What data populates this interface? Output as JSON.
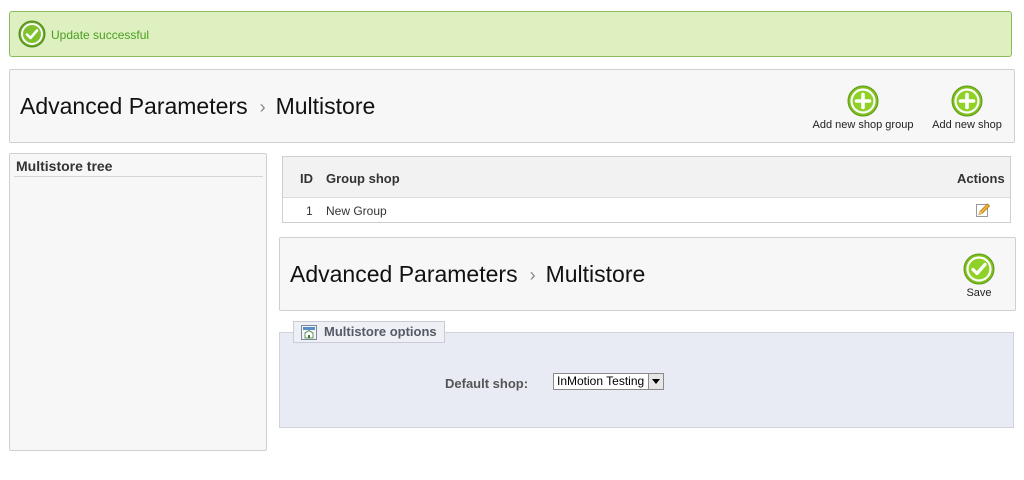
{
  "notification": {
    "message": "Update successful"
  },
  "header": {
    "crumb_parent": "Advanced Parameters",
    "crumb_separator": "›",
    "crumb_current": "Multistore",
    "buttons": {
      "add_shop_group": "Add new shop group",
      "add_shop": "Add new shop"
    }
  },
  "sidebar": {
    "title": "Multistore tree"
  },
  "group_table": {
    "columns": {
      "id": "ID",
      "group_shop": "Group shop",
      "actions": "Actions"
    },
    "rows": [
      {
        "id": "1",
        "group_shop": "New Group"
      }
    ]
  },
  "options_header": {
    "crumb_parent": "Advanced Parameters",
    "crumb_separator": "›",
    "crumb_current": "Multistore",
    "save_label": "Save"
  },
  "options": {
    "legend": "Multistore options",
    "default_shop_label": "Default shop:",
    "default_shop_value": "InMotion Testing"
  },
  "colors": {
    "success_bg": "#dff0c0",
    "success_text": "#479f1f",
    "accent_green": "#7fbf1e"
  },
  "icons": [
    "check-circle-icon",
    "add-circle-icon",
    "save-check-icon",
    "edit-pencil-icon",
    "multistore-icon",
    "dropdown-arrow-icon"
  ]
}
